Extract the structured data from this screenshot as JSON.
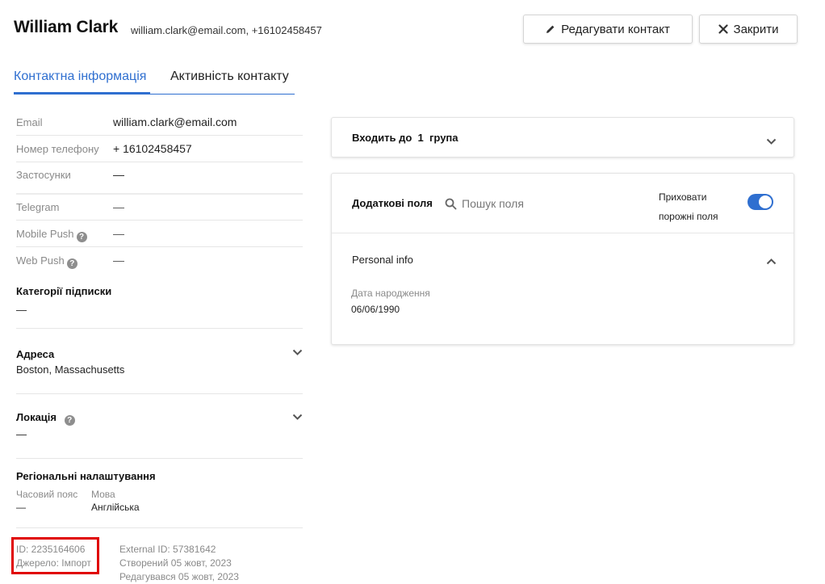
{
  "header": {
    "name": "William Clark",
    "contact_line": "william.clark@email.com, +16102458457",
    "edit_button": "Редагувати контакт",
    "close_button": "Закрити"
  },
  "tabs": [
    {
      "label": "Контактна інформація",
      "active": true
    },
    {
      "label": "Активність контакту",
      "active": false
    }
  ],
  "contact_info": {
    "email_label": "Email",
    "email_value": "william.clark@email.com",
    "phone_label": "Номер телефону",
    "phone_value": "+ 16102458457",
    "apps_label": "Застосунки",
    "apps_value": "—",
    "telegram_label": "Telegram",
    "telegram_value": "—",
    "mobile_push_label": "Mobile Push",
    "mobile_push_value": "—",
    "web_push_label": "Web Push",
    "web_push_value": "—"
  },
  "subscriptions": {
    "title": "Категорії підписки",
    "value": "—"
  },
  "address": {
    "title": "Адреса",
    "value": "Boston, Massachusetts"
  },
  "location": {
    "title": "Локація",
    "value": "—"
  },
  "regional": {
    "title": "Регіональні налаштування",
    "timezone_label": "Часовий пояс",
    "timezone_value": "—",
    "language_label": "Мова",
    "language_value": "Англійська"
  },
  "footer": {
    "id": "ID: 2235164606",
    "source": "Джерело:  Імпорт",
    "external_id": "External ID: 57381642",
    "created": "Створений 05 жовт, 2023",
    "edited": "Редагувався 05 жовт, 2023"
  },
  "groups_card": {
    "prefix": "Входить до",
    "count": "1",
    "suffix": "група"
  },
  "fields_card": {
    "title": "Додаткові поля",
    "search_placeholder": "Пошук поля",
    "hide_empty_line1": "Приховати",
    "hide_empty_line2": "порожні поля",
    "hide_empty_on": true,
    "section_title": "Personal info",
    "birthdate_label": "Дата народження",
    "birthdate_value": "06/06/1990"
  },
  "colors": {
    "accent": "#2f6fd0",
    "highlight": "#e00000"
  }
}
